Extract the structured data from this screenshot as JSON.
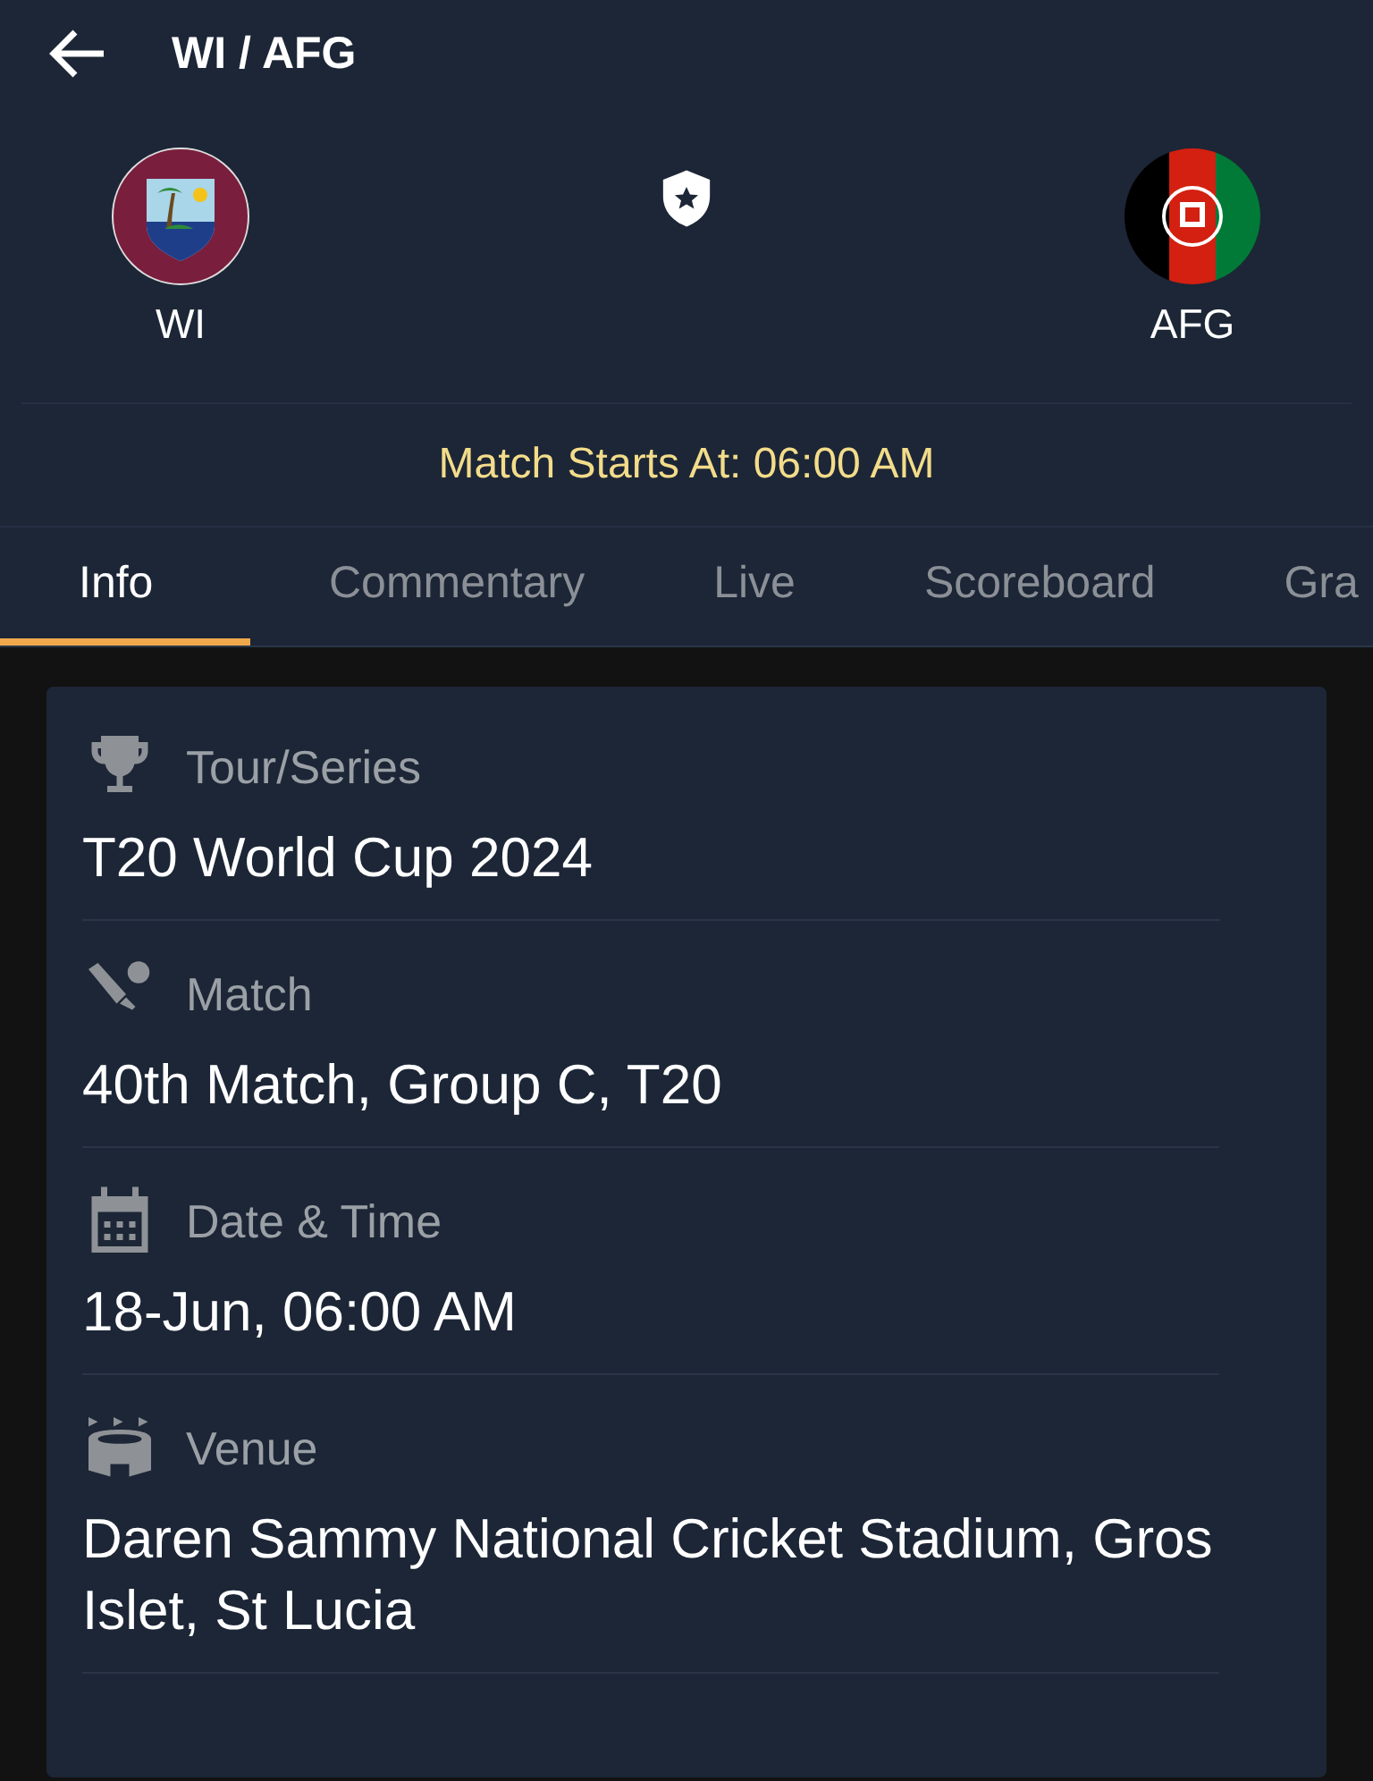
{
  "header": {
    "title": "WI / AFG"
  },
  "teams": [
    {
      "name": "WI",
      "kind": "crest"
    },
    {
      "name": "AFG",
      "kind": "flag"
    }
  ],
  "match_start": "Match Starts At: 06:00 AM",
  "tabs": [
    {
      "label": "Info",
      "selected": true
    },
    {
      "label": "Commentary",
      "selected": false
    },
    {
      "label": "Live",
      "selected": false
    },
    {
      "label": "Scoreboard",
      "selected": false
    },
    {
      "label": "Gra",
      "selected": false
    }
  ],
  "info": [
    {
      "kind": "trophy",
      "label": "Tour/Series",
      "value": "T20 World Cup 2024"
    },
    {
      "kind": "bat",
      "label": "Match",
      "value": "40th Match, Group C, T20"
    },
    {
      "kind": "calendar",
      "label": "Date & Time",
      "value": "18-Jun, 06:00 AM"
    },
    {
      "kind": "stadium",
      "label": "Venue",
      "value": "Daren Sammy National Cricket Stadium, Gros Islet, St Lucia"
    }
  ]
}
